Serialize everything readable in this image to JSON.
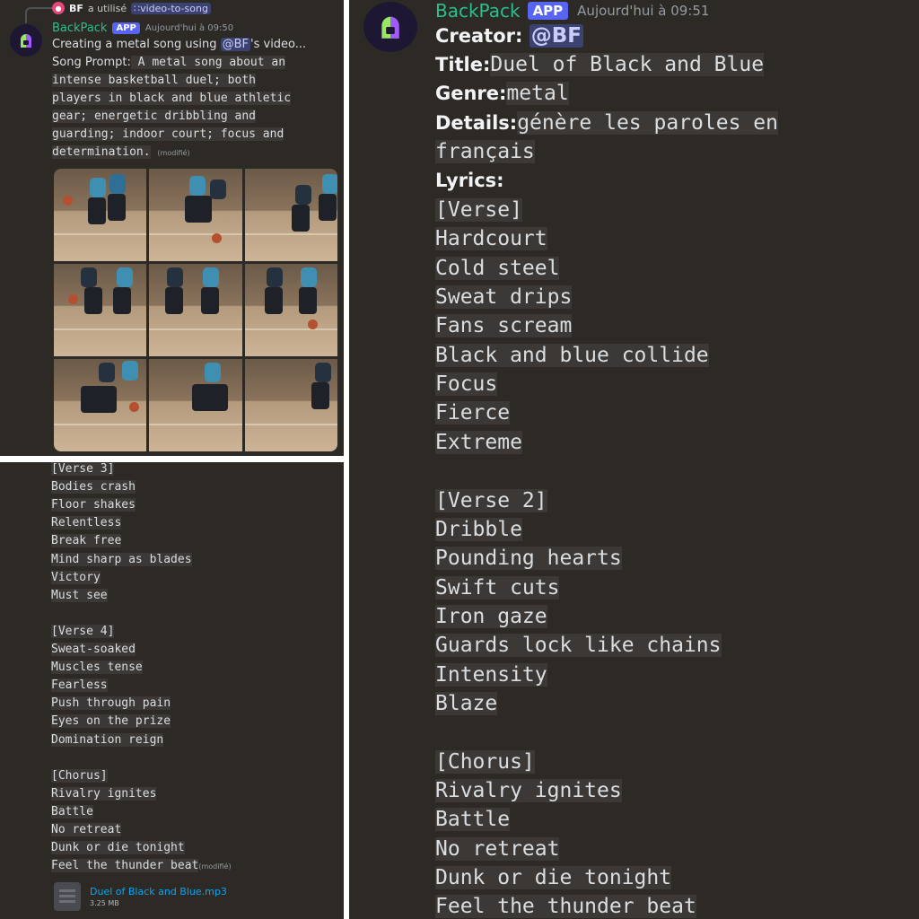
{
  "top_message": {
    "reply": {
      "user": "BF",
      "action": "a utilisé",
      "command": "video-to-song"
    },
    "bot": {
      "name": "BackPack",
      "badge": "APP",
      "timestamp": "Aujourd'hui à 09:50"
    },
    "intro_before": "Creating a metal song using ",
    "intro_mention": "@BF",
    "intro_after": "'s video...",
    "prompt_label": "Song Prompt:",
    "prompt_lines": [
      " A metal song about an",
      "intense basketball duel; both",
      "players in black and blue athletic",
      "gear; energetic dribbling and",
      "guarding; indoor court; focus and",
      "determination."
    ],
    "edited": "(modifié)"
  },
  "bottom_message": {
    "lyrics": [
      "[Verse 3]",
      "Bodies crash",
      "Floor shakes",
      "Relentless",
      "Break free",
      "Mind sharp as blades",
      "Victory",
      "Must see",
      "",
      "[Verse 4]",
      "Sweat-soaked",
      "Muscles tense",
      "Fearless",
      "Push through pain",
      "Eyes on the prize",
      "Domination reign",
      "",
      "[Chorus]",
      "Rivalry ignites",
      "Battle",
      "No retreat",
      "Dunk or die tonight",
      "Feel the thunder beat"
    ],
    "edited": "(modifié)",
    "attachment": {
      "name": "Duel of Black and Blue.mp3",
      "size": "3.25 MB",
      "icon": "file-icon"
    }
  },
  "right_message": {
    "bot": {
      "name": "BackPack",
      "badge": "APP",
      "timestamp": "Aujourd'hui à 09:51"
    },
    "creator_label": "Creator:",
    "creator_value": "@BF",
    "title_label": "Title:",
    "title_value": "Duel of Black and Blue",
    "genre_label": "Genre:",
    "genre_value": "metal",
    "details_label": "Details:",
    "details_value_1": "génère les paroles en",
    "details_value_2": "français",
    "lyrics_label": "Lyrics:",
    "lyrics": [
      "[Verse]",
      "Hardcourt",
      "Cold steel",
      "Sweat drips",
      "Fans scream",
      "Black and blue collide",
      "Focus",
      "Fierce",
      "Extreme",
      "",
      "[Verse 2]",
      "Dribble",
      "Pounding hearts",
      "Swift cuts",
      "Iron gaze",
      "Guards lock like chains",
      "Intensity",
      "Blaze",
      "",
      "[Chorus]",
      "Rivalry ignites",
      "Battle",
      "No retreat",
      "Dunk or die tonight",
      "Feel the thunder beat"
    ]
  },
  "colors": {
    "background": "#2d2a26",
    "bot_name": "#2bbf8e",
    "app_badge": "#5865f2",
    "mention": "#3c4270",
    "link": "#00a8fc"
  }
}
